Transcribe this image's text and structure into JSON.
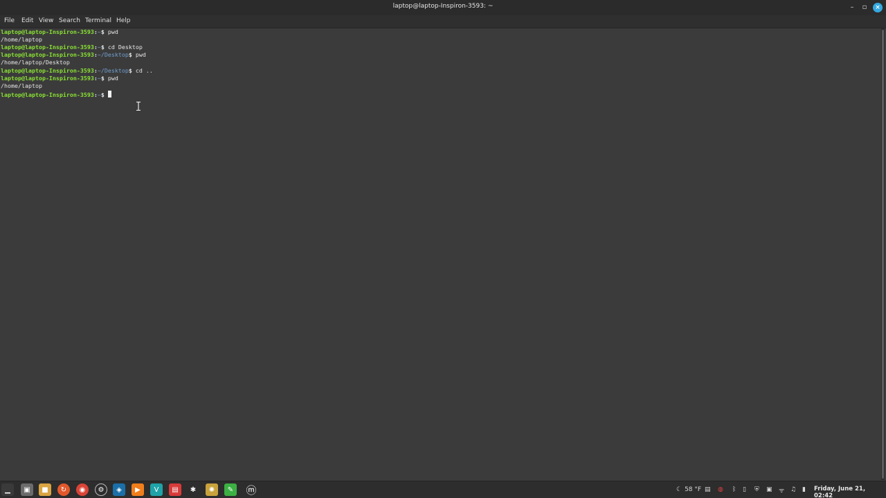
{
  "window": {
    "title": "laptop@laptop-Inspiron-3593: ~",
    "controls": {
      "minimize": "–",
      "maximize": "▫",
      "close": "×"
    }
  },
  "menu": [
    "File",
    "Edit",
    "View",
    "Search",
    "Terminal",
    "Help"
  ],
  "terminal": {
    "lines": [
      {
        "prompt": "laptop@laptop-Inspiron-3593",
        "path": "~",
        "command": "pwd"
      },
      {
        "output": "/home/laptop"
      },
      {
        "prompt": "laptop@laptop-Inspiron-3593",
        "path": "~",
        "command": "cd Desktop"
      },
      {
        "prompt": "laptop@laptop-Inspiron-3593",
        "path": "~/Desktop",
        "command": "pwd"
      },
      {
        "output": "/home/laptop/Desktop"
      },
      {
        "prompt": "laptop@laptop-Inspiron-3593",
        "path": "~/Desktop",
        "command": "cd .."
      },
      {
        "prompt": "laptop@laptop-Inspiron-3593",
        "path": "~",
        "command": "pwd"
      },
      {
        "output": "/home/laptop"
      },
      {
        "prompt": "laptop@laptop-Inspiron-3593",
        "path": "~",
        "command": ""
      }
    ]
  },
  "taskbar": {
    "apps": [
      {
        "name": "show-desktop-icon",
        "glyph": "▁"
      },
      {
        "name": "terminal-icon",
        "glyph": "▣"
      },
      {
        "name": "files-icon",
        "glyph": "■"
      },
      {
        "name": "mintupdate-icon",
        "glyph": "↻"
      },
      {
        "name": "chrome-icon",
        "glyph": "◉"
      },
      {
        "name": "settings-icon",
        "glyph": "⚙"
      },
      {
        "name": "steam-icon",
        "glyph": "◈"
      },
      {
        "name": "media-player-icon",
        "glyph": "▶"
      },
      {
        "name": "app-v-icon",
        "glyph": "V"
      },
      {
        "name": "app-red-icon",
        "glyph": "▤"
      },
      {
        "name": "clapper-icon",
        "glyph": "✱"
      },
      {
        "name": "app-gear-icon",
        "glyph": "✺"
      },
      {
        "name": "app-green-icon",
        "glyph": "✎"
      },
      {
        "name": "mint-menu-icon",
        "glyph": "ⓜ"
      }
    ],
    "tray": {
      "weather": "58 °F",
      "clock": "Friday, June 21, 02:42"
    }
  },
  "colors": {
    "terminal_bg": "#3b3b3b",
    "prompt_green": "#8ae234",
    "path_blue": "#729fcf",
    "text": "#e6e6e6",
    "close_button": "#35a8e0"
  }
}
